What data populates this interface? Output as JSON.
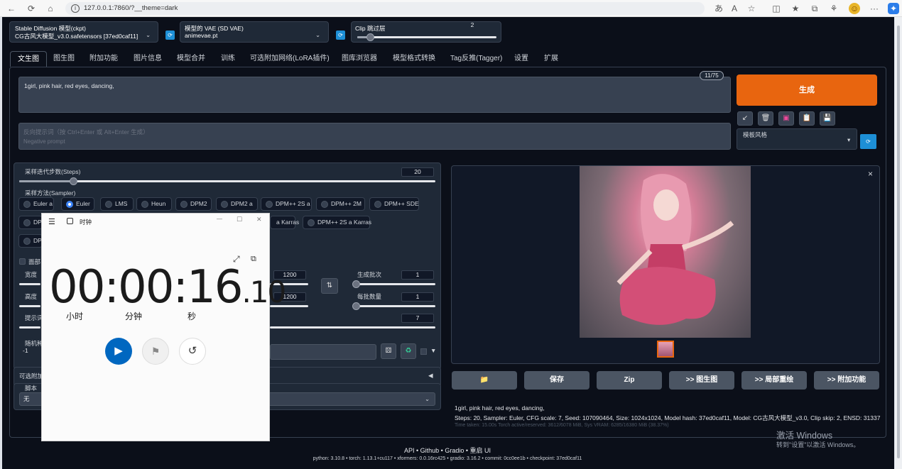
{
  "browser": {
    "url": "127.0.0.1:7860/?__theme=dark",
    "back": "←",
    "forward": "→",
    "reload": "⟳",
    "home": "⌂",
    "info": "i",
    "read_aloud": "あ",
    "text_size": "A",
    "favorites": "☆",
    "split": "◫",
    "collections": "⧉",
    "extensions": "⚘",
    "more": "···"
  },
  "top": {
    "ckpt_label": "Stable Diffusion 模型(ckpt)",
    "ckpt_value": "CG古风大模型_v3.0.safetensors [37ed0caf11]",
    "vae_label": "模型的 VAE (SD VAE)",
    "vae_value": "animevae.pt",
    "clip_label": "Clip 跳过层",
    "clip_value": "2",
    "clip_fraction": 0.09
  },
  "tabs": [
    "文生图",
    "图生图",
    "附加功能",
    "图片信息",
    "模型合并",
    "训练",
    "可选附加网络(LoRA插件)",
    "图库浏览器",
    "模型格式转换",
    "Tag反推(Tagger)",
    "设置",
    "扩展"
  ],
  "prompt": {
    "text": "1girl, pink hair, red eyes, dancing,",
    "token_count": "11/75",
    "neg_placeholder": "反向提示词（按 Ctrl+Enter 或 Alt+Enter 生成）",
    "neg_sub": "Negative prompt"
  },
  "generate": {
    "label": "生成",
    "style_label": "模板风格"
  },
  "tools": [
    "↙",
    "🗑",
    "▣",
    "📋",
    "💾"
  ],
  "params": {
    "steps_label": "采样迭代步数(Steps)",
    "steps_value": "20",
    "steps_fraction": 0.13,
    "sampler_label": "采样方法(Sampler)",
    "samplers_row1": [
      "Euler a",
      "Euler",
      "LMS",
      "Heun",
      "DPM2",
      "DPM2 a",
      "DPM++ 2S a",
      "DPM++ 2M",
      "DPM++ SDE"
    ],
    "samplers_row2_visible": [
      "DP",
      "a Karras",
      "DPM++ 2S a Karras"
    ],
    "samplers_row3_visible": [
      "DP"
    ],
    "selected_sampler": "Euler",
    "facefix_partial": "面部",
    "width_label": "宽度",
    "width_value": "1200",
    "height_label": "高度",
    "height_value": "1200",
    "batch_count_label": "生成批次",
    "batch_count_value": "1",
    "batch_size_label": "每批数量",
    "batch_size_value": "1",
    "cfg_label_partial": "提示词",
    "cfg_value": "7",
    "seed_label_partial": "随机种",
    "seed_value": "-1",
    "extra_network_partial": "可选附加",
    "script_label": "脚本",
    "script_value": "无"
  },
  "output": {
    "caption_line1": "1girl, pink hair, red eyes, dancing,",
    "caption_line2": "Steps: 20, Sampler: Euler, CFG scale: 7, Seed: 107090464, Size: 1024x1024, Model hash: 37ed0caf11, Model: CG古风大模型_v3.0, Clip skip: 2, ENSD: 31337",
    "caption_line3": "Time taken: 15.00s  Torch active/reserved: 3612/6078 MiB, Sys VRAM: 6285/16380 MiB (38.37%)",
    "buttons": [
      "📁",
      "保存",
      "Zip",
      ">> 图生图",
      ">> 局部重绘",
      ">> 附加功能"
    ],
    "close": "×"
  },
  "footer": {
    "links": "API  •  Github  •  Gradio  •  重启 UI",
    "versions": "python: 3.10.8  •  torch: 1.13.1+cu117  •  xformers: 0.0.16rc425  •  gradio: 3.16.2  •  commit: 0cc0ee1b  •  checkpoint: 37ed0caf11"
  },
  "watermark": {
    "line1": "激活 Windows",
    "line2": "转到\"设置\"以激活 Windows。"
  },
  "clock": {
    "app_title": "时钟",
    "time_main": "00:00:16",
    "time_frac": ".10",
    "unit_hours": "小时",
    "unit_minutes": "分钟",
    "unit_seconds": "秒",
    "menu": "☰",
    "minimize": "—",
    "maximize": "☐",
    "close": "✕",
    "expand": "⤢",
    "compact": "⧉",
    "play": "▶",
    "flag": "⚑",
    "reset": "↺"
  },
  "colors": {
    "accent_orange": "#e8650f",
    "app_bg": "#0b0f19",
    "clock_blue": "#0067c0"
  }
}
